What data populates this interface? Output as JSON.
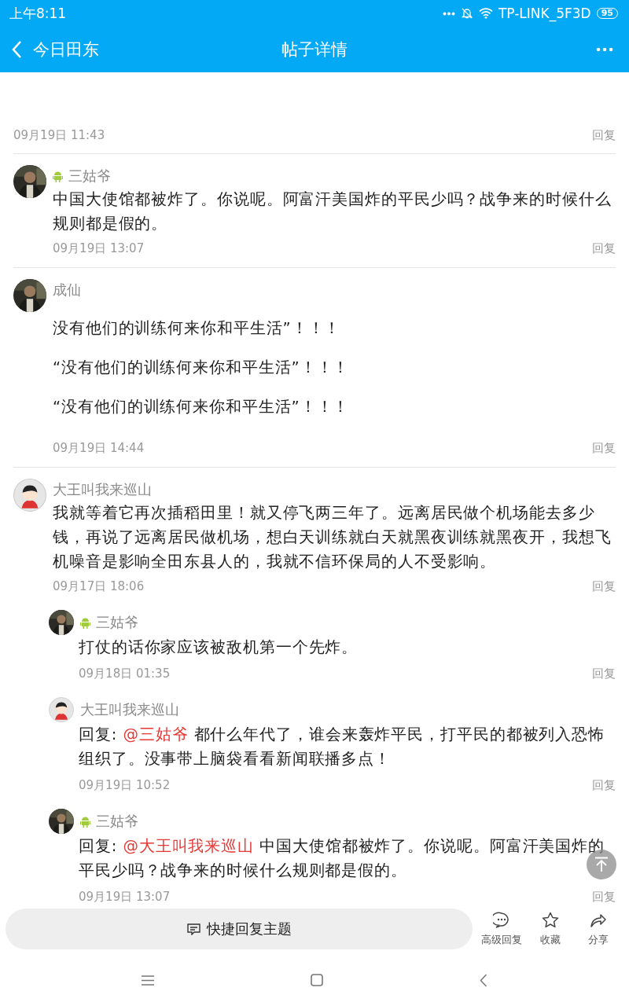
{
  "status_bar": {
    "time": "上午8:11",
    "network": "TP-LINK_5F3D",
    "battery": "95"
  },
  "nav": {
    "back_label": "今日田东",
    "title": "帖子详情"
  },
  "partial_post": {
    "date": "09月19日 11:43",
    "reply_label": "回复"
  },
  "posts": [
    {
      "author": "三姑爷",
      "android": true,
      "paragraphs": [
        "中国大使馆都被炸了。你说呢。阿富汗美国炸的平民少吗？战争来的时候什么规则都是假的。"
      ],
      "date": "09月19日 13:07",
      "reply_label": "回复"
    },
    {
      "author": "成仙",
      "android": false,
      "paragraphs": [
        "没有他们的训练何来你和平生活”！！！",
        "“没有他们的训练何来你和平生活”！！！",
        "“没有他们的训练何来你和平生活”！！！"
      ],
      "date": "09月19日 14:44",
      "reply_label": "回复"
    },
    {
      "author": "大王叫我来巡山",
      "avatar": {
        "kind": "cartoon"
      },
      "android": false,
      "paragraphs": [
        "我就等着它再次插稻田里！就又停飞两三年了。远离居民做个机场能去多少钱，再说了远离居民做机场，想白天训练就白天就黑夜训练就黑夜开，我想飞机噪音是影响全田东县人的，我就不信环保局的人不受影响。"
      ],
      "date": "09月17日 18:06",
      "reply_label": "回复",
      "replies": [
        {
          "author": "三姑爷",
          "android": true,
          "text": "打仗的话你家应该被敌机第一个先炸。",
          "date": "09月18日 01:35",
          "reply_label": "回复"
        },
        {
          "author": "大王叫我来巡山",
          "avatar": {
            "kind": "cartoon"
          },
          "android": false,
          "prefix": "回复: ",
          "mention": "@三姑爷",
          "text": " 都什么年代了，谁会来轰炸平民，打平民的都被列入恐怖组织了。没事带上脑袋看看新闻联播多点！",
          "date": "09月19日 10:52",
          "reply_label": "回复"
        },
        {
          "author": "三姑爷",
          "android": true,
          "prefix": "回复: ",
          "mention": "@大王叫我来巡山",
          "text": " 中国大使馆都被炸了。你说呢。阿富汗美国炸的平民少吗？战争来的时候什么规则都是假的。",
          "date": "09月19日 13:07",
          "reply_label": "回复"
        }
      ]
    }
  ],
  "bottom_bar": {
    "quick_reply": "快捷回复主题",
    "actions": [
      {
        "kind": "comment",
        "label": "高级回复"
      },
      {
        "kind": "star",
        "label": "收藏"
      },
      {
        "kind": "share",
        "label": "分享"
      }
    ]
  }
}
